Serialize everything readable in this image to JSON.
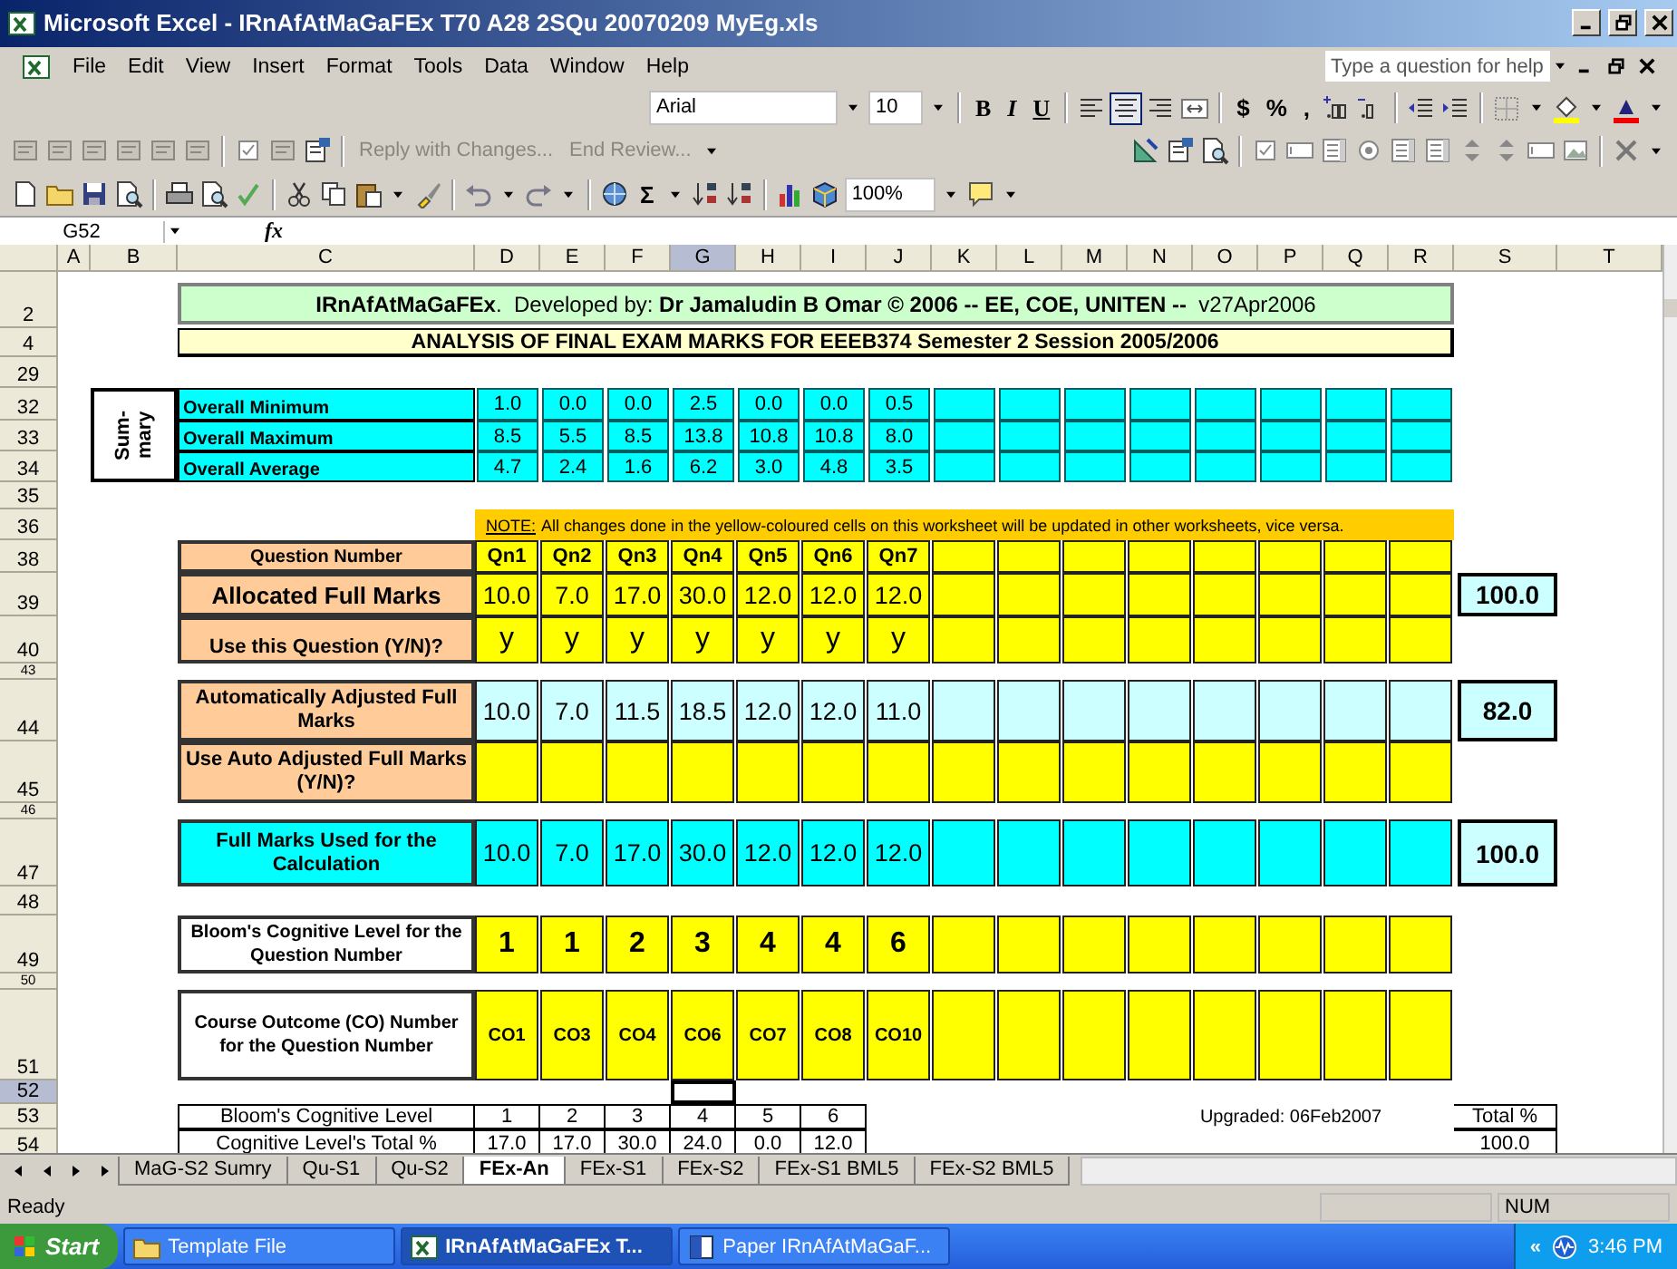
{
  "window": {
    "title": "Microsoft Excel - IRnAfAtMaGaFEx T70 A28 2SQu 20070209 MyEg.xls"
  },
  "menu": [
    "File",
    "Edit",
    "View",
    "Insert",
    "Format",
    "Tools",
    "Data",
    "Window",
    "Help"
  ],
  "help_box": {
    "placeholder": "Type a question for help"
  },
  "formatting": {
    "font": "Arial",
    "size": "10",
    "bold": "B",
    "italic": "I",
    "underline": "U",
    "align_center_on": true,
    "currency": "$",
    "percent": "%",
    "comma": ","
  },
  "reviewing": {
    "reply": "Reply with Changes...",
    "end_review": "End Review..."
  },
  "standard": {
    "autosum": "Σ",
    "zoom": "100%"
  },
  "formula_bar": {
    "name_box": "G52",
    "fx": "fx"
  },
  "sheet": {
    "columns": [
      {
        "label": "A",
        "selected": false
      },
      {
        "label": "B",
        "selected": false
      },
      {
        "label": "C",
        "selected": false
      },
      {
        "label": "D",
        "selected": false
      },
      {
        "label": "E",
        "selected": false
      },
      {
        "label": "F",
        "selected": false
      },
      {
        "label": "G",
        "selected": true
      },
      {
        "label": "H",
        "selected": false
      },
      {
        "label": "I",
        "selected": false
      },
      {
        "label": "J",
        "selected": false
      },
      {
        "label": "K",
        "selected": false
      },
      {
        "label": "L",
        "selected": false
      },
      {
        "label": "M",
        "selected": false
      },
      {
        "label": "N",
        "selected": false
      },
      {
        "label": "O",
        "selected": false
      },
      {
        "label": "P",
        "selected": false
      },
      {
        "label": "Q",
        "selected": false
      },
      {
        "label": "R",
        "selected": false
      },
      {
        "label": "S",
        "selected": false
      },
      {
        "label": "T",
        "selected": false
      }
    ],
    "rows": [
      {
        "number": "2",
        "selected": false
      },
      {
        "number": "4",
        "selected": false
      },
      {
        "number": "29",
        "selected": false
      },
      {
        "number": "32",
        "selected": false
      },
      {
        "number": "33",
        "selected": false
      },
      {
        "number": "34",
        "selected": false
      },
      {
        "number": "35",
        "selected": false
      },
      {
        "number": "36",
        "selected": false
      },
      {
        "number": "38",
        "selected": false
      },
      {
        "number": "39",
        "selected": false
      },
      {
        "number": "40",
        "selected": false
      },
      {
        "number": "43",
        "selected": false
      },
      {
        "number": "44",
        "selected": false
      },
      {
        "number": "45",
        "selected": false
      },
      {
        "number": "46",
        "selected": false
      },
      {
        "number": "47",
        "selected": false
      },
      {
        "number": "48",
        "selected": false
      },
      {
        "number": "49",
        "selected": false
      },
      {
        "number": "50",
        "selected": false
      },
      {
        "number": "51",
        "selected": false
      },
      {
        "number": "52",
        "selected": true
      },
      {
        "number": "53",
        "selected": false
      },
      {
        "number": "54",
        "selected": false
      }
    ],
    "banner": "**IRnAfAtMaGaFEx**.  Developed by: **Dr Jamaludin B Omar © 2006 -- EE, COE, UNITEN --**  v27Apr2006",
    "heading": "ANALYSIS OF FINAL EXAM MARKS FOR EEEB374 Semester 2 Session 2005/2006",
    "summary": {
      "side_label": [
        "Sum-",
        "mary"
      ],
      "rows": [
        {
          "label": "Overall Minimum",
          "values": [
            "1.0",
            "0.0",
            "0.0",
            "2.5",
            "0.0",
            "0.0",
            "0.5"
          ]
        },
        {
          "label": "Overall Maximum",
          "values": [
            "8.5",
            "5.5",
            "8.5",
            "13.8",
            "10.8",
            "10.8",
            "8.0"
          ]
        },
        {
          "label": "Overall Average",
          "values": [
            "4.7",
            "2.4",
            "1.6",
            "6.2",
            "3.0",
            "4.8",
            "3.5"
          ]
        }
      ]
    },
    "note": {
      "label": "NOTE:",
      "text": "All changes done in the yellow-coloured cells on this worksheet will be updated in other worksheets, vice versa."
    },
    "marks_rows": [
      {
        "kind": "question_number",
        "label": "Question Number",
        "cells": [
          "Qn1",
          "Qn2",
          "Qn3",
          "Qn4",
          "Qn5",
          "Qn6",
          "Qn7"
        ]
      },
      {
        "kind": "allocated",
        "label": "Allocated Full Marks",
        "cells": [
          "10.0",
          "7.0",
          "17.0",
          "30.0",
          "12.0",
          "12.0",
          "12.0"
        ],
        "total": "100.0"
      },
      {
        "kind": "use",
        "label": "Use this Question (Y/N)?",
        "cells": [
          "y",
          "y",
          "y",
          "y",
          "y",
          "y",
          "y"
        ]
      },
      {
        "kind": "auto_adjusted",
        "label": "Automatically Adjusted Full Marks",
        "cells": [
          "10.0",
          "7.0",
          "11.5",
          "18.5",
          "12.0",
          "12.0",
          "11.0"
        ],
        "total": "82.0"
      },
      {
        "kind": "use_auto",
        "label": "Use Auto Adjusted Full Marks (Y/N)?"
      },
      {
        "kind": "full_marks",
        "label": "Full Marks Used for the Calculation",
        "cells": [
          "10.0",
          "7.0",
          "17.0",
          "30.0",
          "12.0",
          "12.0",
          "12.0"
        ],
        "total": "100.0"
      },
      {
        "kind": "bloom",
        "label": "Bloom's Cognitive Level for the Question Number",
        "cells": [
          "1",
          "1",
          "2",
          "3",
          "4",
          "4",
          "6"
        ]
      },
      {
        "kind": "co",
        "label": "Course Outcome (CO) Number for the Question Number",
        "cells": [
          "CO1",
          "CO3",
          "CO4",
          "CO6",
          "CO7",
          "CO8",
          "CO10"
        ]
      }
    ],
    "cognitive_table": {
      "rows": [
        {
          "label": "Bloom's Cognitive Level",
          "values": [
            "1",
            "2",
            "3",
            "4",
            "5",
            "6"
          ],
          "total": "Total %"
        },
        {
          "label": "Cognitive Level's Total %",
          "values": [
            "17.0",
            "17.0",
            "30.0",
            "24.0",
            "0.0",
            "12.0"
          ],
          "total": "100.0"
        }
      ]
    },
    "upgraded": "Upgraded: 06Feb2007"
  },
  "sheet_tabs": [
    {
      "label": "MaG-S2 Sumry",
      "selected": false
    },
    {
      "label": "Qu-S1",
      "selected": false
    },
    {
      "label": "Qu-S2",
      "selected": false
    },
    {
      "label": "FEx-An",
      "selected": true
    },
    {
      "label": "FEx-S1",
      "selected": false
    },
    {
      "label": "FEx-S2",
      "selected": false
    },
    {
      "label": "FEx-S1 BML5",
      "selected": false
    },
    {
      "label": "FEx-S2 BML5",
      "selected": false
    }
  ],
  "status_bar": {
    "text": "Ready",
    "num": "NUM"
  },
  "taskbar": {
    "start": "Start",
    "buttons": [
      {
        "label": "Template File",
        "selected": false
      },
      {
        "label": "IRnAfAtMaGaFEx T...",
        "selected": true
      },
      {
        "label": "Paper IRnAfAtMaGaF...",
        "selected": false
      }
    ],
    "tray_arrow": "«",
    "time": "3:46 PM"
  }
}
